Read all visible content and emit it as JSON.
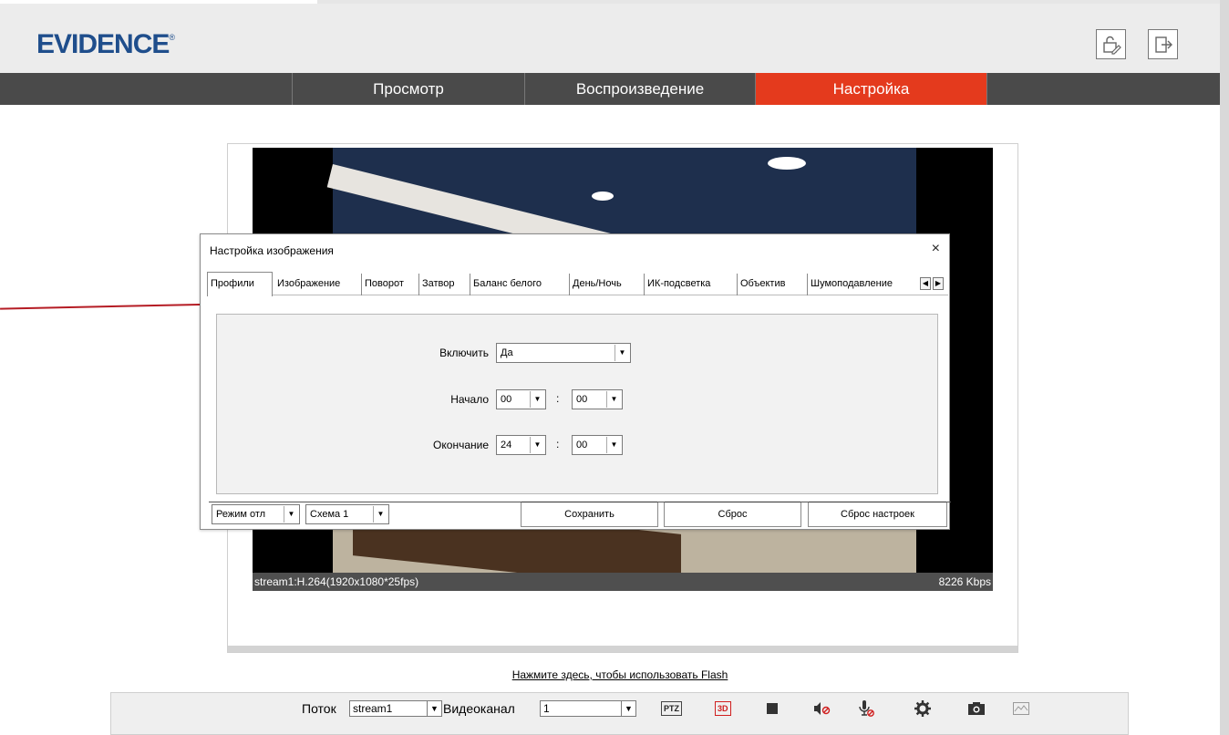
{
  "brand": {
    "logo_text": "EVIDENCE",
    "logo_mark": "®"
  },
  "header_icons": [
    {
      "name": "lock-edit-icon"
    },
    {
      "name": "logout-icon"
    }
  ],
  "nav": {
    "items": [
      {
        "label": "Просмотр",
        "active": false
      },
      {
        "label": "Воспроизведение",
        "active": false
      },
      {
        "label": "Настройка",
        "active": true
      }
    ]
  },
  "video": {
    "stream_info": "stream1:H.264(1920x1080*25fps)",
    "bitrate": "8226 Kbps"
  },
  "dialog": {
    "title": "Настройка изображения",
    "close_glyph": "×",
    "tabs": [
      {
        "label": "Профили",
        "active": true
      },
      {
        "label": "Изображение"
      },
      {
        "label": "Поворот"
      },
      {
        "label": "Затвор"
      },
      {
        "label": "Баланс белого"
      },
      {
        "label": "День/Ночь"
      },
      {
        "label": "ИК-подсветка"
      },
      {
        "label": "Объектив"
      },
      {
        "label": "Шумоподавление"
      }
    ],
    "scroll_left": "◀",
    "scroll_right": "▶",
    "form": {
      "enable_label": "Включить",
      "enable_value": "Да",
      "start_label": "Начало",
      "start_hour": "00",
      "start_minute": "00",
      "end_label": "Окончание",
      "end_hour": "24",
      "end_minute": "00",
      "colon": ":"
    },
    "bottom": {
      "mode_select": "Режим отл",
      "scheme_select": "Схема 1",
      "save_label": "Сохранить",
      "reset_label": "Сброс",
      "reset_settings_label": "Сброс настроек"
    }
  },
  "flash_link": "Нажмите здесь, чтобы использовать Flash",
  "toolbar": {
    "stream_label": "Поток",
    "stream_value": "stream1",
    "channel_label": "Видеоканал",
    "channel_value": "1",
    "ptz_label": "PTZ",
    "threed_label": "3D",
    "icons": [
      "stop-icon",
      "mute-icon",
      "mic-off-icon",
      "settings-icon",
      "camera-icon",
      "chart-icon"
    ]
  },
  "colors": {
    "nav_bg": "#4a4a4a",
    "nav_active": "#e43a1d",
    "logo": "#1f4e8c",
    "pointer": "#b51c24"
  }
}
